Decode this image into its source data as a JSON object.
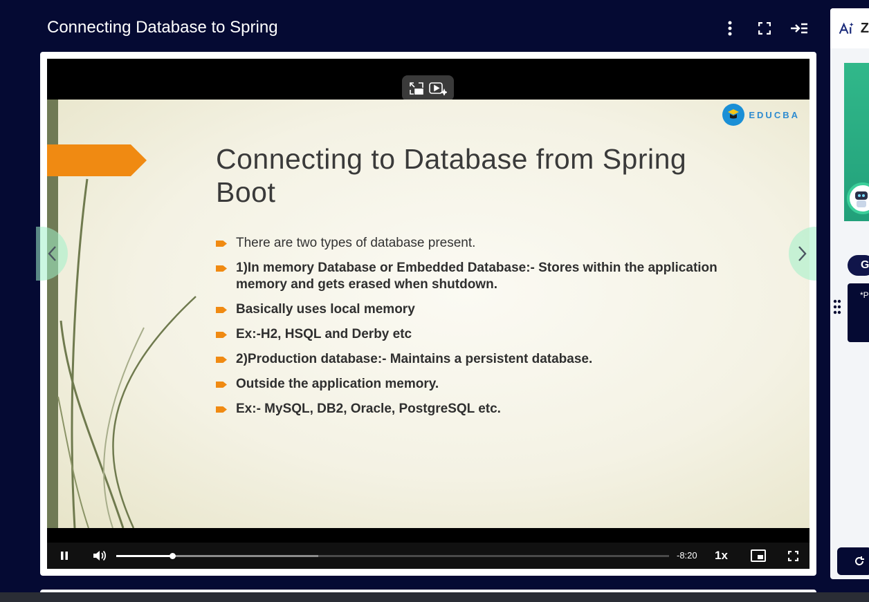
{
  "header": {
    "title": "Connecting Database to Spring",
    "menu_icon": "kebab-menu-icon",
    "fullscreen_icon": "expand-icon",
    "collapse_icon": "collapse-sidebar-icon"
  },
  "slide": {
    "heading_line1": "Connecting to Database from Spring",
    "heading_line2": "Boot",
    "logo_text": "EDUCBA",
    "bullets": [
      "There are two types of database present.",
      "1)In memory Database or  Embedded Database:- Stores within the application memory and gets erased when shutdown.",
      "Basically uses local memory",
      "Ex:-H2, HSQL and Derby etc",
      "2)Production database:- Maintains a persistent database.",
      "Outside the application memory.",
      "Ex:- MySQL, DB2, Oracle, PostgreSQL etc."
    ]
  },
  "player": {
    "time_remaining": "-8:20",
    "speed": "1x",
    "progress_fraction": 0.101,
    "buffered_fraction": 0.365,
    "overlay_icons": [
      "exit-pip-icon",
      "ai-video-icon"
    ]
  },
  "side_panel": {
    "tab_label": "Z",
    "pill_label": "G",
    "note_text": "*P"
  },
  "colors": {
    "page_bg": "#050a33",
    "accent_orange": "#f08a12",
    "nav_green": "#a0f0c8",
    "side_video_green": "#31b88a"
  }
}
